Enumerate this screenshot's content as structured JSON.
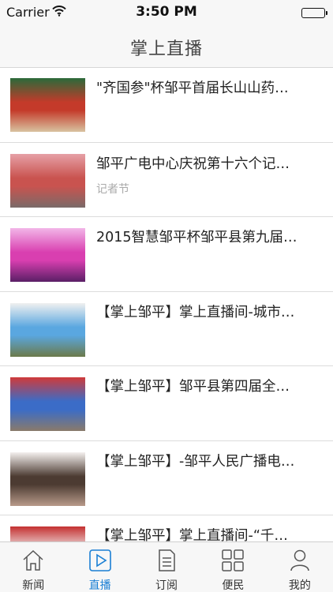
{
  "status_bar": {
    "carrier": "Carrier",
    "time": "3:50 PM",
    "battery_level": 1.0
  },
  "nav": {
    "title": "掌上直播"
  },
  "items": [
    {
      "title": "\"齐国参\"杯邹平首届长山山药…",
      "subtitle": "",
      "thumb_colors": [
        "#c43a2a",
        "#2a6a3a",
        "#d8c2a0"
      ]
    },
    {
      "title": "邹平广电中心庆祝第十六个记…",
      "subtitle": "记者节",
      "thumb_colors": [
        "#c9534f",
        "#e6a0a6",
        "#7a6a68"
      ]
    },
    {
      "title": "2015智慧邹平杯邹平县第九届…",
      "subtitle": "",
      "thumb_colors": [
        "#d93fb0",
        "#f2b6e8",
        "#5a1f66"
      ]
    },
    {
      "title": "【掌上邹平】掌上直播间-城市…",
      "subtitle": "",
      "thumb_colors": [
        "#5aa7e0",
        "#f0f0f0",
        "#6b7a4a"
      ]
    },
    {
      "title": "【掌上邹平】邹平县第四届全…",
      "subtitle": "",
      "thumb_colors": [
        "#3b6cc7",
        "#d03a3a",
        "#8a7a6a"
      ]
    },
    {
      "title": "【掌上邹平】-邹平人民广播电…",
      "subtitle": "",
      "thumb_colors": [
        "#4c3b32",
        "#f4f0ee",
        "#b89a8a"
      ]
    },
    {
      "title": "【掌上邹平】掌上直播间-“千…",
      "subtitle": "",
      "thumb_colors": [
        "#f2f2f2",
        "#c43030",
        "#7a3a2a"
      ]
    }
  ],
  "tabs": [
    {
      "label": "新闻",
      "icon": "home-icon",
      "active": false
    },
    {
      "label": "直播",
      "icon": "play-icon",
      "active": true
    },
    {
      "label": "订阅",
      "icon": "document-icon",
      "active": false
    },
    {
      "label": "便民",
      "icon": "grid-icon",
      "active": false
    },
    {
      "label": "我的",
      "icon": "person-icon",
      "active": false
    }
  ],
  "colors": {
    "accent": "#1a7fd4",
    "bar_bg": "#f7f7f7",
    "divider": "#dcdcdc"
  }
}
